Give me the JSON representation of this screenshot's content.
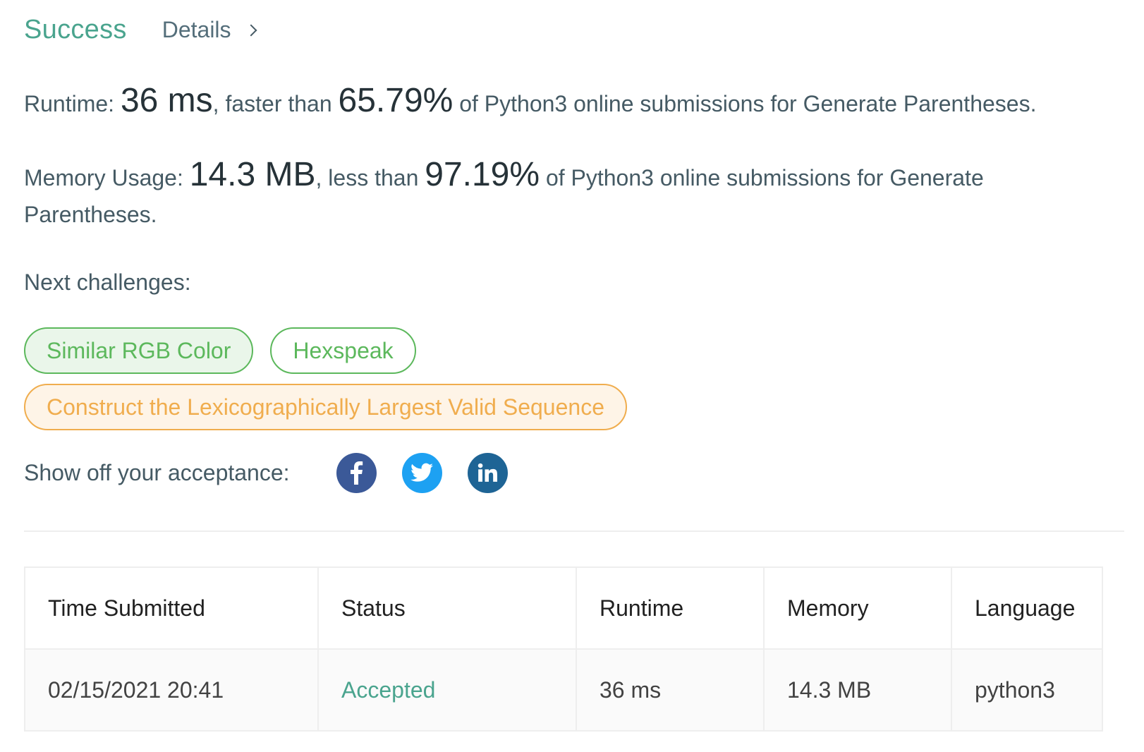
{
  "header": {
    "status": "Success",
    "details_label": "Details"
  },
  "runtime": {
    "label": "Runtime:",
    "value": "36 ms",
    "comparison": ", faster than ",
    "percent": "65.79%",
    "suffix": " of Python3 online submissions for Generate Parentheses."
  },
  "memory": {
    "label": "Memory Usage:",
    "value": "14.3 MB",
    "comparison": ", less than ",
    "percent": "97.19%",
    "suffix": " of Python3 online submissions for Generate Parentheses."
  },
  "next_challenges": {
    "label": "Next challenges:",
    "items": [
      {
        "title": "Similar RGB Color",
        "difficulty": "easy"
      },
      {
        "title": "Hexspeak",
        "difficulty": "easy"
      },
      {
        "title": "Construct the Lexicographically Largest Valid Sequence",
        "difficulty": "medium"
      }
    ]
  },
  "share": {
    "label": "Show off your acceptance:",
    "networks": [
      "facebook-icon",
      "twitter-icon",
      "linkedin-icon"
    ]
  },
  "colors": {
    "success": "#4aa48e",
    "easy": "#5cb85c",
    "medium": "#f0ad4e",
    "facebook": "#3b5998",
    "twitter": "#1da1f2",
    "linkedin": "#1e6495"
  },
  "submissions": {
    "headers": [
      "Time Submitted",
      "Status",
      "Runtime",
      "Memory",
      "Language"
    ],
    "rows": [
      [
        "02/15/2021 20:41",
        "Accepted",
        "36 ms",
        "14.3 MB",
        "python3"
      ]
    ]
  }
}
